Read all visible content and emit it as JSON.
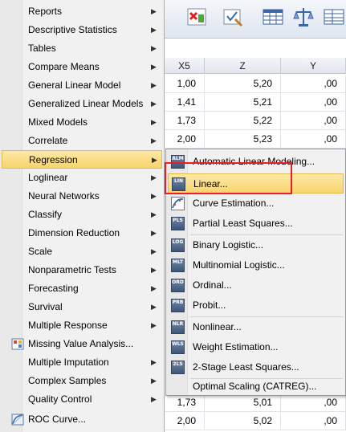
{
  "menu": {
    "items": [
      {
        "label": "Reports",
        "arrow": "▶"
      },
      {
        "label": "Descriptive Statistics",
        "arrow": "▶"
      },
      {
        "label": "Tables",
        "arrow": "▶"
      },
      {
        "label": "Compare Means",
        "arrow": "▶"
      },
      {
        "label": "General Linear Model",
        "arrow": "▶"
      },
      {
        "label": "Generalized Linear Models",
        "arrow": "▶"
      },
      {
        "label": "Mixed Models",
        "arrow": "▶"
      },
      {
        "label": "Correlate",
        "arrow": "▶"
      },
      {
        "label": "Regression",
        "arrow": "▶"
      },
      {
        "label": "Loglinear",
        "arrow": "▶"
      },
      {
        "label": "Neural Networks",
        "arrow": "▶"
      },
      {
        "label": "Classify",
        "arrow": "▶"
      },
      {
        "label": "Dimension Reduction",
        "arrow": "▶"
      },
      {
        "label": "Scale",
        "arrow": "▶"
      },
      {
        "label": "Nonparametric Tests",
        "arrow": "▶"
      },
      {
        "label": "Forecasting",
        "arrow": "▶"
      },
      {
        "label": "Survival",
        "arrow": "▶"
      },
      {
        "label": "Multiple Response",
        "arrow": "▶"
      },
      {
        "label": "Missing Value Analysis...",
        "arrow": ""
      },
      {
        "label": "Multiple Imputation",
        "arrow": "▶"
      },
      {
        "label": "Complex Samples",
        "arrow": "▶"
      },
      {
        "label": "Quality Control",
        "arrow": "▶"
      },
      {
        "label": "ROC Curve...",
        "arrow": ""
      }
    ],
    "highlighted": "Regression"
  },
  "submenu": {
    "items": [
      {
        "label": "Automatic Linear Modeling...",
        "icon_text": "ALM"
      },
      {
        "label": "Linear...",
        "icon_text": "LIN"
      },
      {
        "label": "Curve Estimation...",
        "icon_text": "CE"
      },
      {
        "label": "Partial Least Squares...",
        "icon_text": "PLS"
      },
      {
        "label": "Binary Logistic...",
        "icon_text": "LOG"
      },
      {
        "label": "Multinomial Logistic...",
        "icon_text": "MLT"
      },
      {
        "label": "Ordinal...",
        "icon_text": "ORD"
      },
      {
        "label": "Probit...",
        "icon_text": "PRB"
      },
      {
        "label": "Nonlinear...",
        "icon_text": "NLR"
      },
      {
        "label": "Weight Estimation...",
        "icon_text": "WLS"
      },
      {
        "label": "2-Stage Least Squares...",
        "icon_text": "2LS"
      },
      {
        "label": "Optimal Scaling (CATREG)...",
        "icon_text": ""
      }
    ],
    "highlighted": "Linear..."
  },
  "grid": {
    "columns": [
      "X5",
      "Z",
      "Y"
    ],
    "rows": [
      [
        "1,00",
        "5,20",
        ",00"
      ],
      [
        "1,41",
        "5,21",
        ",00"
      ],
      [
        "1,73",
        "5,22",
        ",00"
      ],
      [
        "2,00",
        "5,23",
        ",00"
      ],
      [
        "1,73",
        "5,01",
        ",00"
      ],
      [
        "2,00",
        "5,02",
        ",00"
      ]
    ]
  },
  "colors": {
    "highlight": "#f8d46c",
    "annotation_box": "#ec1f24",
    "menu_bg": "#f1f1f1"
  }
}
